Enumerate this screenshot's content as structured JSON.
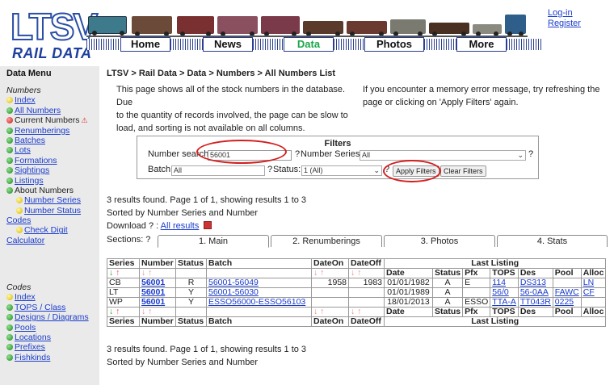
{
  "header": {
    "logo_big": "LTSV",
    "logo_sub": "RAIL DATA",
    "nav": [
      {
        "label": "Home",
        "active": false
      },
      {
        "label": "News",
        "active": false
      },
      {
        "label": "Data",
        "active": true
      },
      {
        "label": "Photos",
        "active": false
      },
      {
        "label": "More",
        "active": false
      }
    ],
    "login": "Log-in",
    "register": "Register"
  },
  "sidebar": {
    "title": "Data Menu",
    "numbers_head": "Numbers",
    "numbers": [
      {
        "label": "Index",
        "dot": "yellow",
        "link": true
      },
      {
        "label": "All Numbers",
        "dot": "green",
        "link": true
      },
      {
        "label": "Current Numbers",
        "dot": "red",
        "link": false,
        "warn": true
      },
      {
        "label": "Renumberings",
        "dot": "green",
        "link": true
      },
      {
        "label": "Batches",
        "dot": "green",
        "link": true
      },
      {
        "label": "Lots",
        "dot": "green",
        "link": true
      },
      {
        "label": "Formations",
        "dot": "green",
        "link": true
      },
      {
        "label": "Sightings",
        "dot": "green",
        "link": true
      },
      {
        "label": "Listings",
        "dot": "green",
        "link": true
      },
      {
        "label": "About Numbers",
        "dot": "green",
        "link": false
      },
      {
        "label": "Number Series",
        "dot": "yellow",
        "link": true,
        "indent": true
      },
      {
        "label": "Number Status",
        "dot": "yellow",
        "link": true,
        "indent": true
      }
    ],
    "codes_link": "Codes",
    "check_digit": "Check Digit",
    "calculator": "Calculator",
    "codes_head": "Codes",
    "codes": [
      {
        "label": "Index",
        "dot": "yellow"
      },
      {
        "label": "TOPS / Class",
        "dot": "green"
      },
      {
        "label": "Designs / Diagrams",
        "dot": "green"
      },
      {
        "label": "Pools",
        "dot": "green"
      },
      {
        "label": "Locations",
        "dot": "green"
      },
      {
        "label": "Prefixes",
        "dot": "green"
      },
      {
        "label": "Fishkinds",
        "dot": "green"
      }
    ]
  },
  "main": {
    "breadcrumb": "LTSV > Rail Data > Data > Numbers > All Numbers List",
    "intro_left": [
      "This page shows all of the stock numbers in the database. Due",
      "to the quantity of records involved, the page can be slow to",
      "load, and sorting is not available on all columns."
    ],
    "intro_right": [
      "If you encounter a memory error message, try refreshing the",
      "page or clicking on 'Apply Filters' again."
    ],
    "filters": {
      "title": "Filters",
      "number_search_label": "Number search:",
      "number_search_value": "56001",
      "help": "?",
      "number_series_label": "Number Series:",
      "number_series_value": "All",
      "batch_label": "Batch:",
      "batch_value": "All",
      "status_label": "Status:",
      "status_value": "1 (All)",
      "apply": "Apply Filters",
      "clear": "Clear Filters"
    },
    "results_line": "3 results found. Page 1 of 1, showing results 1 to 3",
    "sorted_line": "Sorted by Number Series and Number",
    "download_label": "Download ? :",
    "download_link": "All results",
    "sections_label": "Sections: ?",
    "sections": [
      "1. Main",
      "2. Renumberings",
      "3. Photos",
      "4. Stats"
    ],
    "table": {
      "headers": [
        "Series",
        "Number",
        "Status",
        "Batch",
        "DateOn",
        "DateOff"
      ],
      "last_listing": "Last Listing",
      "ll_headers": [
        "Date",
        "Status",
        "Pfx",
        "TOPS",
        "Des",
        "Pool",
        "Alloc"
      ],
      "rows": [
        {
          "series": "CB",
          "number": "56001",
          "status": "R",
          "batch": "56001-56049",
          "dateon": "1958",
          "dateoff": "1983",
          "date": "01/01/1982",
          "lstatus": "A",
          "pfx": "E",
          "tops": "114",
          "des": "DS313",
          "pool": "",
          "alloc": "LN"
        },
        {
          "series": "LT",
          "number": "56001",
          "status": "Y",
          "batch": "56001-56030",
          "dateon": "",
          "dateoff": "",
          "date": "01/01/1989",
          "lstatus": "A",
          "pfx": "",
          "tops": "56/0",
          "des": "56-0AA",
          "pool": "FAWC",
          "alloc": "CF"
        },
        {
          "series": "WP",
          "number": "56001",
          "status": "Y",
          "batch": "ESSO56000-ESSO56103",
          "dateon": "",
          "dateoff": "",
          "date": "18/01/2013",
          "lstatus": "A",
          "pfx": "ESSO",
          "tops": "TTA-A",
          "des": "TT043R",
          "pool": "0225",
          "alloc": ""
        }
      ]
    },
    "results_line_bottom": "3 results found. Page 1 of 1, showing results 1 to 3",
    "sorted_line_bottom": "Sorted by Number Series and Number"
  },
  "colors": {
    "accent_red": "#d41e1e",
    "link": "#1a3ccc",
    "active_nav": "#1aa64a",
    "sidebar_bg": "#eaeaea"
  }
}
